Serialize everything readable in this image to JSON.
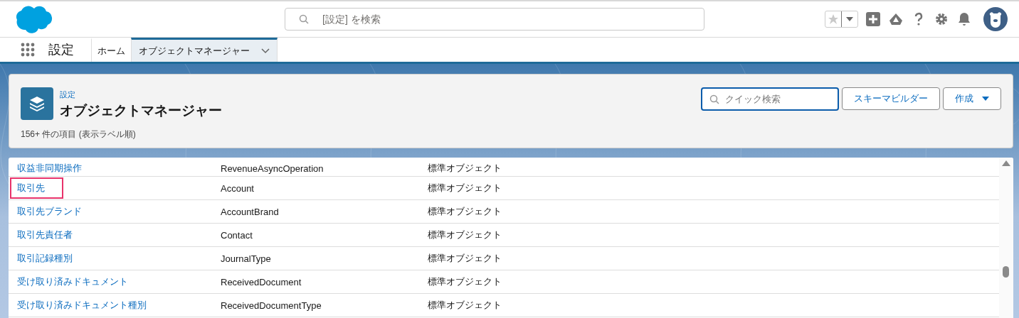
{
  "global_search": {
    "placeholder": "[設定] を検索"
  },
  "nav": {
    "app_name": "設定",
    "tabs": [
      {
        "label": "ホーム",
        "selected": false,
        "has_menu": false
      },
      {
        "label": "オブジェクトマネージャー",
        "selected": true,
        "has_menu": true
      }
    ]
  },
  "page_header": {
    "breadcrumb": "設定",
    "title": "オブジェクトマネージャー",
    "subtitle": "156+ 件の項目 (表示ラベル順)",
    "quick_search": {
      "placeholder": "クイック検索"
    },
    "buttons": [
      {
        "label": "スキーマビルダー",
        "kind": "plain"
      },
      {
        "label": "作成",
        "kind": "menu"
      }
    ]
  },
  "table": {
    "rows": [
      {
        "label": "収益非同期操作",
        "api_name": "RevenueAsyncOperation",
        "type": "標準オブジェクト",
        "highlighted": false
      },
      {
        "label": "取引先",
        "api_name": "Account",
        "type": "標準オブジェクト",
        "highlighted": true
      },
      {
        "label": "取引先ブランド",
        "api_name": "AccountBrand",
        "type": "標準オブジェクト",
        "highlighted": false
      },
      {
        "label": "取引先責任者",
        "api_name": "Contact",
        "type": "標準オブジェクト",
        "highlighted": false
      },
      {
        "label": "取引記録種別",
        "api_name": "JournalType",
        "type": "標準オブジェクト",
        "highlighted": false
      },
      {
        "label": "受け取り済みドキュメント",
        "api_name": "ReceivedDocument",
        "type": "標準オブジェクト",
        "highlighted": false
      },
      {
        "label": "受け取り済みドキュメント種別",
        "api_name": "ReceivedDocumentType",
        "type": "標準オブジェクト",
        "highlighted": false
      }
    ]
  }
}
